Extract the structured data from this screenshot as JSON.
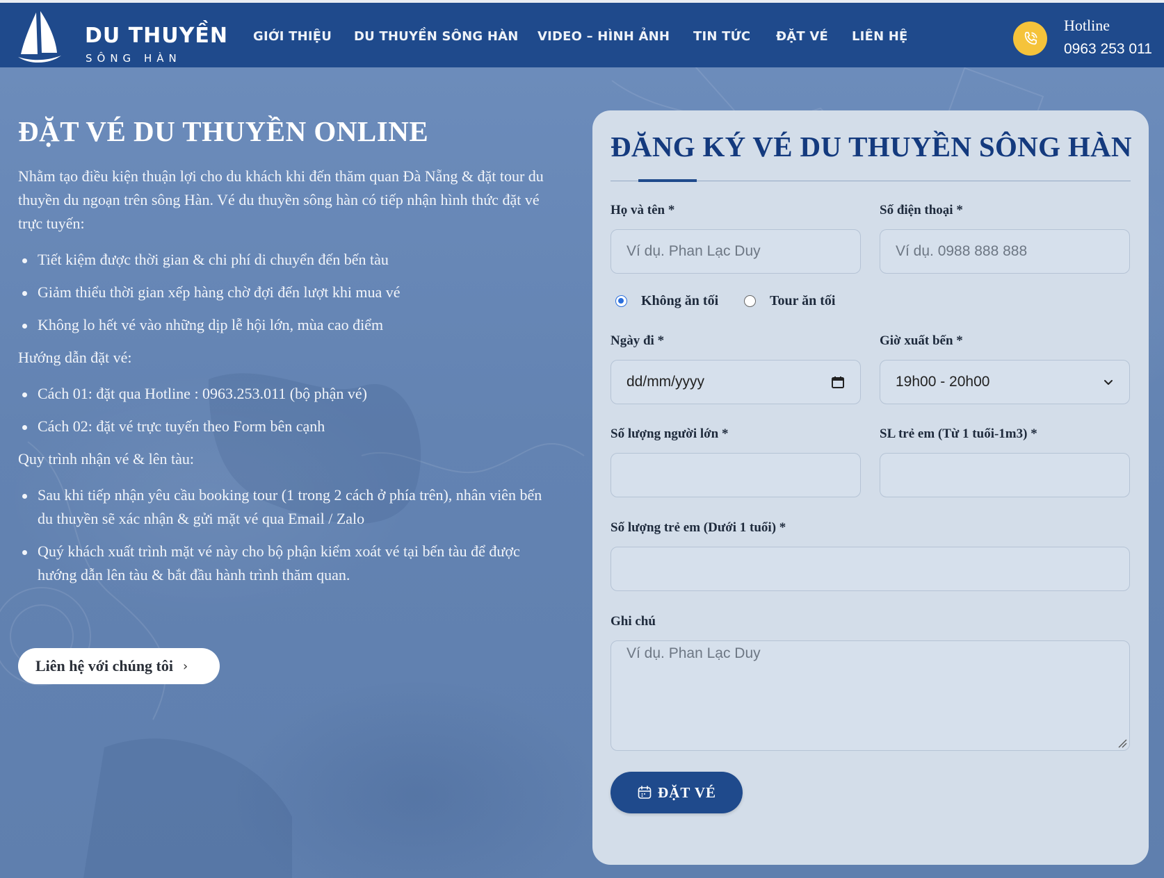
{
  "header": {
    "logo_title": "DU THUYỀN",
    "logo_subtitle": "SÔNG HÀN",
    "nav": [
      {
        "label": "GIỚI THIỆU"
      },
      {
        "label": "DU THUYỀN SÔNG HÀN"
      },
      {
        "label": "VIDEO – HÌNH ẢNH"
      },
      {
        "label": "TIN TỨC"
      },
      {
        "label": "ĐẶT VÉ"
      },
      {
        "label": "LIÊN HỆ"
      }
    ],
    "hotline_label": "Hotline",
    "hotline_number": "0963 253 011",
    "hotline_icon": "phone-icon",
    "colors": {
      "bar": "#1f4a8c",
      "hotline_circle": "#f5c33b"
    }
  },
  "intro": {
    "title": "ĐẶT VÉ DU THUYỀN ONLINE",
    "text": "Nhằm tạo điều kiện thuận lợi cho du khách khi đến thăm quan Đà Nẵng & đặt tour du thuyền du ngoạn trên sông Hàn. Vé du thuyền sông hàn có tiếp nhận hình thức đặt vé trực tuyến:",
    "benefits": [
      "Tiết kiệm được thời gian & chi phí di chuyển đến bến tàu",
      "Giảm thiểu thời gian xếp hàng chờ đợi đến lượt khi mua vé",
      "Không lo hết vé vào những dịp lễ hội lớn, mùa cao điểm"
    ],
    "guide_title": "Hướng dẫn đặt vé:",
    "guide": [
      "Cách 01: đặt qua Hotline : 0963.253.011 (bộ phận vé)",
      "Cách 02: đặt vé trực tuyến theo Form bên cạnh"
    ],
    "process_title": "Quy trình nhận vé & lên tàu:",
    "process": [
      "Sau khi tiếp nhận yêu cầu booking tour (1 trong 2 cách ở phía trên), nhân viên bến du thuyền sẽ xác nhận & gửi mặt vé qua Email / Zalo",
      "Quý khách xuất trình mặt vé này cho bộ phận kiểm xoát vé tại bến tàu để được hướng dẫn lên tàu & bắt đầu hành trình thăm quan."
    ],
    "contact_button": "Liên hệ với chúng tôi",
    "contact_chevron": "›"
  },
  "form": {
    "title": "ĐĂNG KÝ VÉ DU THUYỀN SÔNG HÀN",
    "name_label": "Họ và tên *",
    "name_placeholder": "Ví dụ. Phan Lạc Duy",
    "phone_label": "Số điện thoại *",
    "phone_placeholder": "Ví dụ. 0988 888 888",
    "option_no_dinner": "Không ăn tối",
    "option_dinner": "Tour ăn tối",
    "selected_option": "Không ăn tối",
    "date_label": "Ngày đi *",
    "date_value": "dd/mm/yyyy",
    "time_label": "Giờ xuất bến *",
    "time_value": "19h00 - 20h00",
    "adults_label": "Số lượng người lớn *",
    "children_label": "SL trẻ em (Từ 1 tuổi-1m3) *",
    "infants_label": "Số lượng trẻ em (Dưới 1 tuổi) *",
    "note_label": "Ghi chú",
    "note_placeholder": "Ví dụ. Phan Lạc Duy",
    "submit_label": "ĐẶT VÉ",
    "colors": {
      "card": "#d3dde9",
      "title": "#143a7e",
      "button": "#1f4a8c",
      "radio": "#2b6fdc"
    }
  }
}
